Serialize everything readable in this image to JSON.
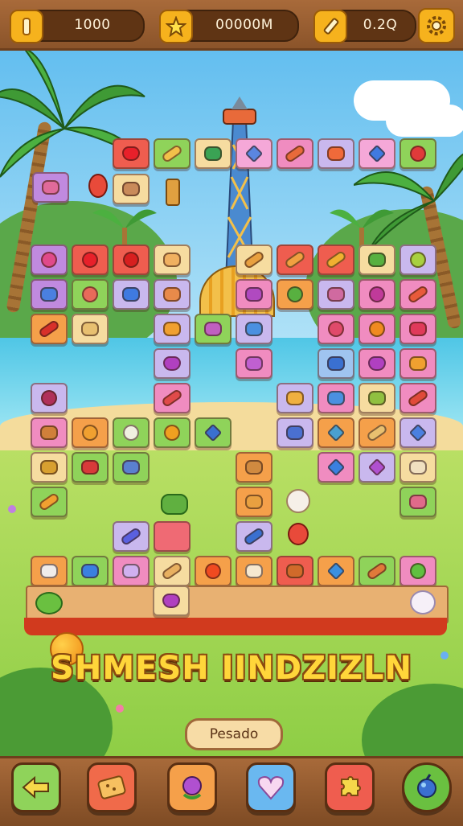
{
  "hud": {
    "coins_value": "1000",
    "stars_value": "00000M",
    "hint_value": "0.2Q"
  },
  "game": {
    "title": "SHMESH IINDZIZLN",
    "status_label": "Pesado"
  },
  "icons": {
    "coin": "coin-icon",
    "star": "star-icon",
    "pencil": "pencil-icon",
    "settings": "gear-icon",
    "back": "back-arrow-icon",
    "shuffle": "cracker-icon",
    "hint": "rose-icon",
    "heart": "heart-icon",
    "puzzle": "puzzle-icon",
    "bomb": "bomb-icon"
  },
  "colors": {
    "hud_wood": "#8b542a",
    "title_yellow": "#ffd63a",
    "tile_pink": "#f08cc0",
    "tile_green": "#8fd35a",
    "tile_orange": "#f5a04a",
    "tile_lavender": "#c9b8ee",
    "tile_red": "#ee5a56",
    "tile_cream": "#f6dca0",
    "tile_blue": "#9fc4f0"
  },
  "board": {
    "tiles": [
      {
        "col": 0,
        "row": 0,
        "bg": "#ef5d4f",
        "g": "#e8202a",
        "n": "heart"
      },
      {
        "col": 1,
        "row": 0,
        "bg": "#8fd35a",
        "g": "#f3c04a",
        "n": "bread"
      },
      {
        "col": 2,
        "row": 0,
        "bg": "#f6dca0",
        "g": "#3aa354",
        "n": "leaf"
      },
      {
        "col": 3,
        "row": 0,
        "bg": "#f5a8d8",
        "g": "#5a86e0",
        "n": "gem"
      },
      {
        "col": 4,
        "row": 0,
        "bg": "#f08cc0",
        "g": "#e86a3a",
        "n": "carrot"
      },
      {
        "col": 5,
        "row": 0,
        "bg": "#c9b8ee",
        "g": "#f06a3a",
        "n": "bow"
      },
      {
        "col": 6,
        "row": 0,
        "bg": "#f5a8d8",
        "g": "#3f7ae0",
        "n": "diamond"
      },
      {
        "col": 7,
        "row": 0,
        "bg": "#8fd35a",
        "g": "#e03a3a",
        "n": "apple"
      },
      {
        "col": 0,
        "row": 1,
        "bg": "#f6dca0",
        "g": "#c98a5a",
        "n": "face"
      },
      {
        "col": -2,
        "row": 8,
        "bg": "#c08adf",
        "g": "#e06a9a",
        "n": "girl"
      },
      {
        "col": -2,
        "row": 3,
        "bg": "#c08adf",
        "g": "#e04a8a",
        "n": "berry"
      },
      {
        "col": -1,
        "row": 3,
        "bg": "#ef5d4f",
        "g": "#e8202a",
        "n": "apple"
      },
      {
        "col": 0,
        "row": 3,
        "bg": "#ef5d4f",
        "g": "#d81f1f",
        "n": "apple"
      },
      {
        "col": 1,
        "row": 3,
        "bg": "#f6dca0",
        "g": "#f0b060",
        "n": "cheese"
      },
      {
        "col": 3,
        "row": 3,
        "bg": "#f6dca0",
        "g": "#e8a040",
        "n": "bread"
      },
      {
        "col": 4,
        "row": 3,
        "bg": "#ef5d4f",
        "g": "#f0a040",
        "n": "corn"
      },
      {
        "col": 5,
        "row": 3,
        "bg": "#ef5d4f",
        "g": "#f0b030",
        "n": "corn"
      },
      {
        "col": 6,
        "row": 3,
        "bg": "#f6dca0",
        "g": "#58b040",
        "n": "leaf"
      },
      {
        "col": 7,
        "row": 3,
        "bg": "#c9b8ee",
        "g": "#a8d040",
        "n": "apple"
      },
      {
        "col": -2,
        "row": 4,
        "bg": "#c08adf",
        "g": "#4a80e0",
        "n": "figure"
      },
      {
        "col": -1,
        "row": 4,
        "bg": "#8fd35a",
        "g": "#e86a5a",
        "n": "melon"
      },
      {
        "col": 0,
        "row": 4,
        "bg": "#c9b8ee",
        "g": "#3f7ae0",
        "n": "milk"
      },
      {
        "col": 1,
        "row": 4,
        "bg": "#c9b8ee",
        "g": "#e88a4a",
        "n": "bun"
      },
      {
        "col": 3,
        "row": 4,
        "bg": "#f08cc0",
        "g": "#b04ac0",
        "n": "candy"
      },
      {
        "col": 4,
        "row": 4,
        "bg": "#f5a04a",
        "g": "#58b040",
        "n": "pea"
      },
      {
        "col": 5,
        "row": 4,
        "bg": "#c9b8ee",
        "g": "#d06aa0",
        "n": "flower"
      },
      {
        "col": 6,
        "row": 4,
        "bg": "#f08cc0",
        "g": "#c03a9a",
        "n": "plum"
      },
      {
        "col": 7,
        "row": 4,
        "bg": "#f08cc0",
        "g": "#e85a3a",
        "n": "chili"
      },
      {
        "col": -2,
        "row": 5,
        "bg": "#f5a04a",
        "g": "#d8302a",
        "n": "chili"
      },
      {
        "col": -1,
        "row": 5,
        "bg": "#f6dca0",
        "g": "#e8c070",
        "n": "cracker"
      },
      {
        "col": 1,
        "row": 5,
        "bg": "#c9b8ee",
        "g": "#f0a030",
        "n": "pear"
      },
      {
        "col": 2,
        "row": 5,
        "bg": "#8fd35a",
        "g": "#c060c0",
        "n": "onion"
      },
      {
        "col": 3,
        "row": 5,
        "bg": "#c9b8ee",
        "g": "#4a90e0",
        "n": "jar"
      },
      {
        "col": 5,
        "row": 5,
        "bg": "#f08cc0",
        "g": "#e04a6a",
        "n": "berry"
      },
      {
        "col": 6,
        "row": 5,
        "bg": "#f08cc0",
        "g": "#f08a20",
        "n": "orange"
      },
      {
        "col": 7,
        "row": 5,
        "bg": "#f08cc0",
        "g": "#e03a5a",
        "n": "strawberry"
      },
      {
        "col": 1,
        "row": 6,
        "bg": "#c9b8ee",
        "g": "#b040c0",
        "n": "heart"
      },
      {
        "col": 3,
        "row": 6,
        "bg": "#f08cc0",
        "g": "#c060d0",
        "n": "jelly"
      },
      {
        "col": 5,
        "row": 6,
        "bg": "#9fc4f0",
        "g": "#3a70d0",
        "n": "cup"
      },
      {
        "col": 6,
        "row": 6,
        "bg": "#f08cc0",
        "g": "#b040c0",
        "n": "heart"
      },
      {
        "col": 7,
        "row": 6,
        "bg": "#f08cc0",
        "g": "#f0a030",
        "n": "bug"
      },
      {
        "col": -2,
        "row": 7,
        "bg": "#c9b8ee",
        "g": "#b0305a",
        "n": "berry"
      },
      {
        "col": 1,
        "row": 7,
        "bg": "#f08cc0",
        "g": "#e04a4a",
        "n": "carrot"
      },
      {
        "col": 4,
        "row": 7,
        "bg": "#c9b8ee",
        "g": "#f0b040",
        "n": "jar"
      },
      {
        "col": 5,
        "row": 7,
        "bg": "#f08cc0",
        "g": "#4a90e0",
        "n": "bowl"
      },
      {
        "col": 6,
        "row": 7,
        "bg": "#f6dca0",
        "g": "#90c040",
        "n": "grapes"
      },
      {
        "col": 7,
        "row": 7,
        "bg": "#f08cc0",
        "g": "#e04a3a",
        "n": "carrot"
      },
      {
        "col": -2,
        "row": 8,
        "bg": "#f08cc0",
        "g": "#d0803a",
        "n": "basket"
      },
      {
        "col": -1,
        "row": 8,
        "bg": "#f5a04a",
        "g": "#f0a030",
        "n": "lemon"
      },
      {
        "col": 0,
        "row": 8,
        "bg": "#8fd35a",
        "g": "#f0f0e0",
        "n": "egg"
      },
      {
        "col": 1,
        "row": 8,
        "bg": "#8fd35a",
        "g": "#f0a020",
        "n": "orange"
      },
      {
        "col": 2,
        "row": 8,
        "bg": "#8fd35a",
        "g": "#3a70d0",
        "n": "gem"
      },
      {
        "col": 4,
        "row": 8,
        "bg": "#c9b8ee",
        "g": "#4a70d0",
        "n": "figure"
      },
      {
        "col": 5,
        "row": 8,
        "bg": "#f5a04a",
        "g": "#4aa0d0",
        "n": "shard"
      },
      {
        "col": 6,
        "row": 8,
        "bg": "#f5a04a",
        "g": "#e8c070",
        "n": "bone"
      },
      {
        "col": 7,
        "row": 8,
        "bg": "#c9b8ee",
        "g": "#4a80e0",
        "n": "crystal"
      },
      {
        "col": -2,
        "row": 9,
        "bg": "#f6dca0",
        "g": "#d8a030",
        "n": "honey"
      },
      {
        "col": -1,
        "row": 9,
        "bg": "#8fd35a",
        "g": "#d83a3a",
        "n": "cake"
      },
      {
        "col": 0,
        "row": 9,
        "bg": "#8fd35a",
        "g": "#5a80d0",
        "n": "bell"
      },
      {
        "col": 3,
        "row": 9,
        "bg": "#f5a04a",
        "g": "#d08a40",
        "n": "cheese"
      },
      {
        "col": 5,
        "row": 9,
        "bg": "#f08cc0",
        "g": "#3a80e0",
        "n": "gem"
      },
      {
        "col": 6,
        "row": 9,
        "bg": "#c9b8ee",
        "g": "#b050d0",
        "n": "crystal"
      },
      {
        "col": 7,
        "row": 9,
        "bg": "#f6dca0",
        "g": "#f0e0c0",
        "n": "jar"
      },
      {
        "col": -2,
        "row": 10,
        "bg": "#8fd35a",
        "g": "#f0a030",
        "n": "pepper"
      },
      {
        "col": 3,
        "row": 10,
        "bg": "#f5a04a",
        "g": "#e8a040",
        "n": "cookie"
      },
      {
        "col": 7,
        "row": 10,
        "bg": "#8fd35a",
        "g": "#e06a8a",
        "n": "flower"
      },
      {
        "col": 0,
        "row": 11,
        "bg": "#c9b8ee",
        "g": "#5a60e0",
        "n": "carrot"
      },
      {
        "col": 1,
        "row": 11,
        "bg": "#ef6a74",
        "g": "#ef6a74",
        "n": "blank"
      },
      {
        "col": 3,
        "row": 11,
        "bg": "#c9b8ee",
        "g": "#3a70d0",
        "n": "pepper"
      },
      {
        "col": -2,
        "row": 12,
        "bg": "#f5a04a",
        "g": "#f0ecea",
        "n": "cake"
      },
      {
        "col": -1,
        "row": 12,
        "bg": "#8fd35a",
        "g": "#3a80e0",
        "n": "soap"
      },
      {
        "col": 0,
        "row": 12,
        "bg": "#f08cc0",
        "g": "#d0b0f0",
        "n": "dumpling"
      },
      {
        "col": 1,
        "row": 12,
        "bg": "#f6dca0",
        "g": "#e8b060",
        "n": "bread"
      },
      {
        "col": 2,
        "row": 12,
        "bg": "#f5a04a",
        "g": "#f04a20",
        "n": "tomato"
      },
      {
        "col": 3,
        "row": 12,
        "bg": "#f5a04a",
        "g": "#f6e8d0",
        "n": "dumpling"
      },
      {
        "col": 4,
        "row": 12,
        "bg": "#ef5d4f",
        "g": "#d06a2a",
        "n": "cake"
      },
      {
        "col": 5,
        "row": 12,
        "bg": "#f5a04a",
        "g": "#3a90e0",
        "n": "gem"
      },
      {
        "col": 6,
        "row": 12,
        "bg": "#8fd35a",
        "g": "#e07a3a",
        "n": "carrot"
      },
      {
        "col": 7,
        "row": 12,
        "bg": "#f08cc0",
        "g": "#60c040",
        "n": "apple"
      },
      {
        "col": 1,
        "row": 13,
        "bg": "#f6dca0",
        "g": "#b040c0",
        "n": "heart"
      }
    ]
  }
}
